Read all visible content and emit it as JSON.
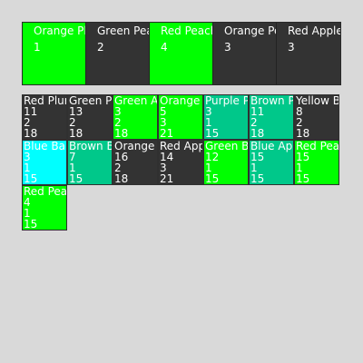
{
  "top_tiles": [
    {
      "name": "Orange Plum",
      "count": "1",
      "color": "#00ff00"
    },
    {
      "name": "Green Peach",
      "count": "2",
      "color": "#333333"
    },
    {
      "name": "Red Peach",
      "count": "4",
      "color": "#00ff00"
    },
    {
      "name": "Orange Peach",
      "count": "3",
      "color": "#333333"
    },
    {
      "name": "Red Apple",
      "count": "3",
      "color": "#333333"
    }
  ],
  "grid_rows": [
    [
      {
        "name": "Red Plum",
        "a": "11",
        "b": "2",
        "c": "18",
        "color": "#333333"
      },
      {
        "name": "Green Peach",
        "a": "13",
        "b": "2",
        "c": "18",
        "color": "#333333"
      },
      {
        "name": "Green Apple",
        "a": "3",
        "b": "2",
        "c": "18",
        "color": "#00ff00"
      },
      {
        "name": "Orange Fig",
        "a": "5",
        "b": "3",
        "c": "21",
        "color": "#00ff00"
      },
      {
        "name": "Purple Plum",
        "a": "3",
        "b": "1",
        "c": "15",
        "color": "#00c88a"
      },
      {
        "name": "Brown Peach",
        "a": "11",
        "b": "2",
        "c": "18",
        "color": "#00c88a"
      },
      {
        "name": "Yellow Banana",
        "a": "8",
        "b": "2",
        "c": "18",
        "color": "#333333"
      }
    ],
    [
      {
        "name": "Blue Banana",
        "a": "3",
        "b": "1",
        "c": "15",
        "color": "#00ffff"
      },
      {
        "name": "Brown Banana",
        "a": "7",
        "b": "1",
        "c": "15",
        "color": "#00c88a"
      },
      {
        "name": "Orange Fig",
        "a": "16",
        "b": "2",
        "c": "18",
        "color": "#333333"
      },
      {
        "name": "Red Apple",
        "a": "14",
        "b": "3",
        "c": "21",
        "color": "#333333"
      },
      {
        "name": "Green Banana",
        "a": "12",
        "b": "1",
        "c": "15",
        "color": "#00ff00"
      },
      {
        "name": "Blue Apple",
        "a": "15",
        "b": "1",
        "c": "15",
        "color": "#00c88a"
      },
      {
        "name": "Red Pear",
        "a": "15",
        "b": "1",
        "c": "15",
        "color": "#00ff00"
      }
    ],
    [
      {
        "name": "Red Peach",
        "a": "4",
        "b": "1",
        "c": "15",
        "color": "#00ff00"
      }
    ]
  ]
}
